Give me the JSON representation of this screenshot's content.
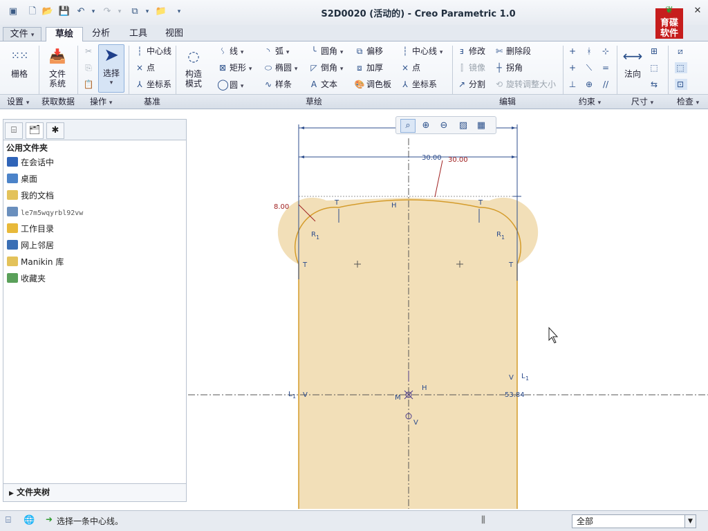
{
  "window": {
    "title": "S2D0020 (活动的) - Creo Parametric 1.0",
    "logo_line1": "育碟",
    "logo_line2": "软件"
  },
  "tabs": [
    {
      "label": "文件"
    },
    {
      "label": "草绘"
    },
    {
      "label": "分析"
    },
    {
      "label": "工具"
    },
    {
      "label": "视图"
    }
  ],
  "ribbon": {
    "setup": {
      "grid": "栅格",
      "group": "设置"
    },
    "getdata": {
      "filesystem_line1": "文件",
      "filesystem_line2": "系统",
      "group": "获取数据"
    },
    "operations": {
      "select": "选择",
      "group": "操作"
    },
    "datum": {
      "centerline": "中心线",
      "point": "点",
      "csys": "坐标系",
      "group": "基准"
    },
    "construct": {
      "line1": "构造",
      "line2": "模式"
    },
    "sketch": {
      "line": "线",
      "rectangle": "矩形",
      "circle": "圆",
      "arc": "弧",
      "ellipse": "椭圆",
      "spline": "样条",
      "fillet": "圆角",
      "chamfer": "倒角",
      "text": "文本",
      "offset": "偏移",
      "thicken": "加厚",
      "palette": "调色板",
      "centerline": "中心线",
      "point": "点",
      "csys": "坐标系",
      "group": "草绘"
    },
    "edit": {
      "modify": "修改",
      "delete_segment": "删除段",
      "mirror": "镜像",
      "corner": "拐角",
      "divide": "分割",
      "rotate_resize": "旋转调整大小",
      "group": "编辑"
    },
    "constrain": {
      "group": "约束"
    },
    "dimension": {
      "normal": "法向",
      "group": "尺寸"
    },
    "inspect": {
      "group": "检查"
    }
  },
  "folders": {
    "title": "公用文件夹",
    "items": [
      {
        "label": "在会话中"
      },
      {
        "label": "桌面"
      },
      {
        "label": "我的文档"
      },
      {
        "label": "le7m5wqyrbl92vw"
      },
      {
        "label": "工作目录"
      },
      {
        "label": "网上邻居"
      },
      {
        "label": "Manikin 库"
      },
      {
        "label": "收藏夹"
      }
    ],
    "footer": "文件夹树"
  },
  "sketch": {
    "dim_30_a": "30.00",
    "dim_30_b": "30.00",
    "dim_8": "8.00",
    "dim_53": "53.84",
    "label_T": "T",
    "label_H": "H",
    "label_V": "V",
    "label_R": "R",
    "label_sub1": "1",
    "label_L": "L",
    "label_M": "M",
    "fill_color": "#f2dfb8",
    "line_color": "#d49b2a",
    "dim_color": "#2c4c8c",
    "dim_red": "#a02020"
  },
  "status": {
    "message": "选择一条中心线。",
    "filter": "全部"
  }
}
